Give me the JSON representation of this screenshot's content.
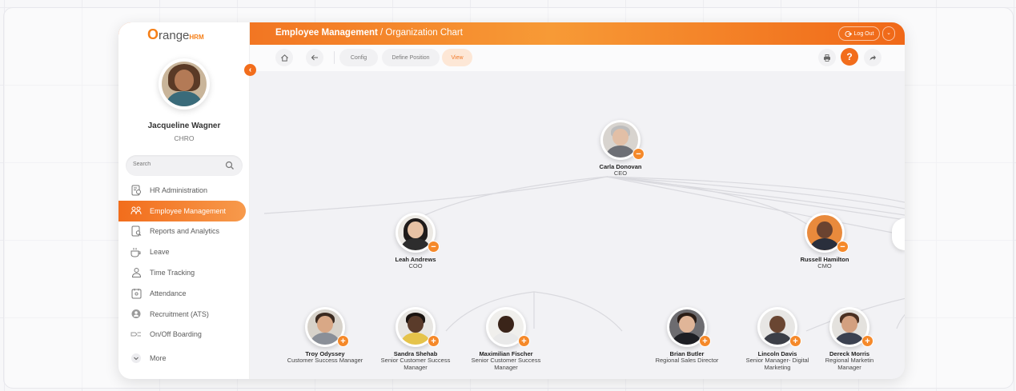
{
  "brand": {
    "logo_main": "range",
    "logo_first": "O",
    "logo_suffix": "HRM"
  },
  "user": {
    "name": "Jacqueline Wagner",
    "role": "CHRO"
  },
  "search": {
    "placeholder": "Search"
  },
  "sidebar": {
    "items": [
      {
        "label": "HR Administration",
        "icon": "admin-icon"
      },
      {
        "label": "Employee Management",
        "icon": "employees-icon",
        "active": true
      },
      {
        "label": "Reports and Analytics",
        "icon": "reports-icon"
      },
      {
        "label": "Leave",
        "icon": "leave-icon"
      },
      {
        "label": "Time Tracking",
        "icon": "time-icon"
      },
      {
        "label": "Attendance",
        "icon": "attendance-icon"
      },
      {
        "label": "Recruitment (ATS)",
        "icon": "recruitment-icon"
      },
      {
        "label": "On/Off Boarding",
        "icon": "onboarding-icon"
      },
      {
        "label": "More",
        "icon": "chevron-down-icon"
      }
    ]
  },
  "header": {
    "title_main": "Employee Management",
    "title_sep": " / ",
    "title_sub": "Organization Chart",
    "logout_label": "Log Out"
  },
  "toolbar": {
    "config_label": "Config",
    "define_label": "Define Position",
    "view_label": "View",
    "help_label": "?"
  },
  "colors": {
    "accent": "#f26d1c",
    "accent_light": "#f79a36"
  },
  "org": {
    "ceo": {
      "name": "Carla Donovan",
      "title": "CEO",
      "badge": "−"
    },
    "coo": {
      "name": "Leah Andrews",
      "title": "COO",
      "badge": "−"
    },
    "cmo": {
      "name": "Russell Hamilton",
      "title": "CMO",
      "badge": "−"
    },
    "reports": [
      {
        "name": "Troy Odyssey",
        "title_1": "Customer Success Manager",
        "title_2": "",
        "badge": "+"
      },
      {
        "name": "Sandra Shehab",
        "title_1": "Senior Customer Success",
        "title_2": "Manager",
        "badge": "+"
      },
      {
        "name": "Maximilian Fischer",
        "title_1": "Senior Customer Success",
        "title_2": "Manager",
        "badge": "+"
      },
      {
        "name": "Brian Butler",
        "title_1": "Regional Sales Director",
        "title_2": "",
        "badge": "+"
      },
      {
        "name": "Lincoln Davis",
        "title_1": "Senior Manager- Digital",
        "title_2": "Marketing",
        "badge": "+"
      },
      {
        "name": "Dereck Morris",
        "title_1": "Regional Marketin",
        "title_2": "Manager",
        "badge": "+"
      }
    ]
  }
}
